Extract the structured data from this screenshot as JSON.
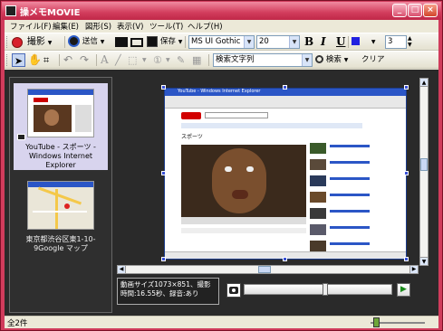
{
  "window": {
    "title": "操メモMOVIE",
    "min_glyph": "_",
    "max_glyph": "□",
    "close_glyph": "×"
  },
  "menu": [
    {
      "label": "ファイル(F)"
    },
    {
      "label": "編集(E)"
    },
    {
      "label": "図形(S)"
    },
    {
      "label": "表示(V)"
    },
    {
      "label": "ツール(T)"
    },
    {
      "label": "ヘルプ(H)"
    }
  ],
  "toolbar1": {
    "record_label": "撮影",
    "send_label": "送信",
    "save_label": "保存",
    "font_name": "MS UI Gothic",
    "font_size": "20",
    "bold": "B",
    "italic": "I",
    "underline": "U",
    "line_width": "3"
  },
  "toolbar2": {
    "text_tool": "A",
    "search_placeholder": "検索文字列",
    "search_label": "検索",
    "clear_label": "クリア"
  },
  "thumbnails": [
    {
      "caption": "YouTube - スポーツ - Windows Internet Explorer",
      "selected": true,
      "icon": "camera-icon"
    },
    {
      "caption": "東京都渋谷区東1-10-9Google マップ",
      "selected": false,
      "icon": "map-image"
    }
  ],
  "capture": {
    "browser_title": "YouTube - Windows Internet Explorer",
    "section_title": "スポーツ"
  },
  "info": {
    "text": "動画サイズ1073×851、撮影時間:16.55秒、録音:あり"
  },
  "playback": {
    "play_glyph": "▶",
    "progress": 0.55
  },
  "status": {
    "count_text": "全2件",
    "zoom": 0.05
  },
  "colors": {
    "frame": "#d03c5c",
    "accent_blue": "#3a52d8"
  }
}
